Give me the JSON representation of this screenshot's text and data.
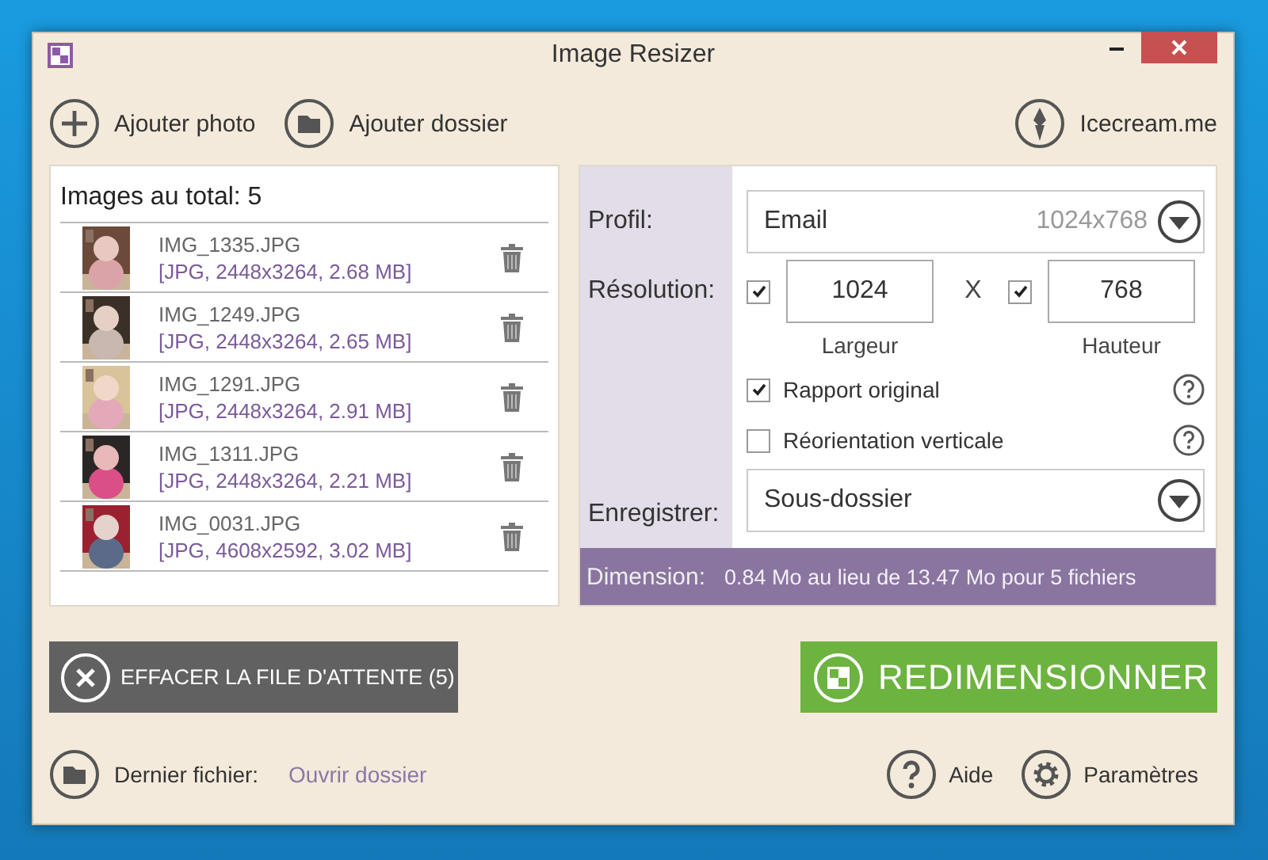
{
  "window": {
    "title": "Image Resizer"
  },
  "toolbar": {
    "add_photo": "Ajouter photo",
    "add_folder": "Ajouter dossier",
    "brand": "Icecream.me"
  },
  "images": {
    "title": "Images au total: 5",
    "items": [
      {
        "name": "IMG_1335.JPG",
        "info": "[JPG, 2448x3264, 2.68 MB]"
      },
      {
        "name": "IMG_1249.JPG",
        "info": "[JPG, 2448x3264, 2.65 MB]"
      },
      {
        "name": "IMG_1291.JPG",
        "info": "[JPG, 2448x3264, 2.91 MB]"
      },
      {
        "name": "IMG_1311.JPG",
        "info": "[JPG, 2448x3264, 2.21 MB]"
      },
      {
        "name": "IMG_0031.JPG",
        "info": "[JPG, 4608x2592, 3.02 MB]"
      }
    ]
  },
  "settings": {
    "profile": {
      "label": "Profil:",
      "value": "Email",
      "hint": "1024x768"
    },
    "resolution": {
      "label": "Résolution:",
      "separator": "X",
      "width": {
        "checked": true,
        "value": "1024",
        "caption": "Largeur"
      },
      "height": {
        "checked": true,
        "value": "768",
        "caption": "Hauteur"
      }
    },
    "options": [
      {
        "label": "Rapport original",
        "checked": true
      },
      {
        "label": "Réorientation verticale",
        "checked": false
      }
    ],
    "save": {
      "label": "Enregistrer:",
      "value": "Sous-dossier"
    },
    "dimension": {
      "label": "Dimension:",
      "text": "0.84 Mo au lieu de 13.47 Mo pour 5 fichiers"
    }
  },
  "actions": {
    "clear": "EFFACER LA FILE D'ATTENTE (5)",
    "resize": "REDIMENSIONNER"
  },
  "footer": {
    "last_file": "Dernier fichier:",
    "open_folder": "Ouvrir dossier",
    "help": "Aide",
    "settings": "Paramètres"
  }
}
